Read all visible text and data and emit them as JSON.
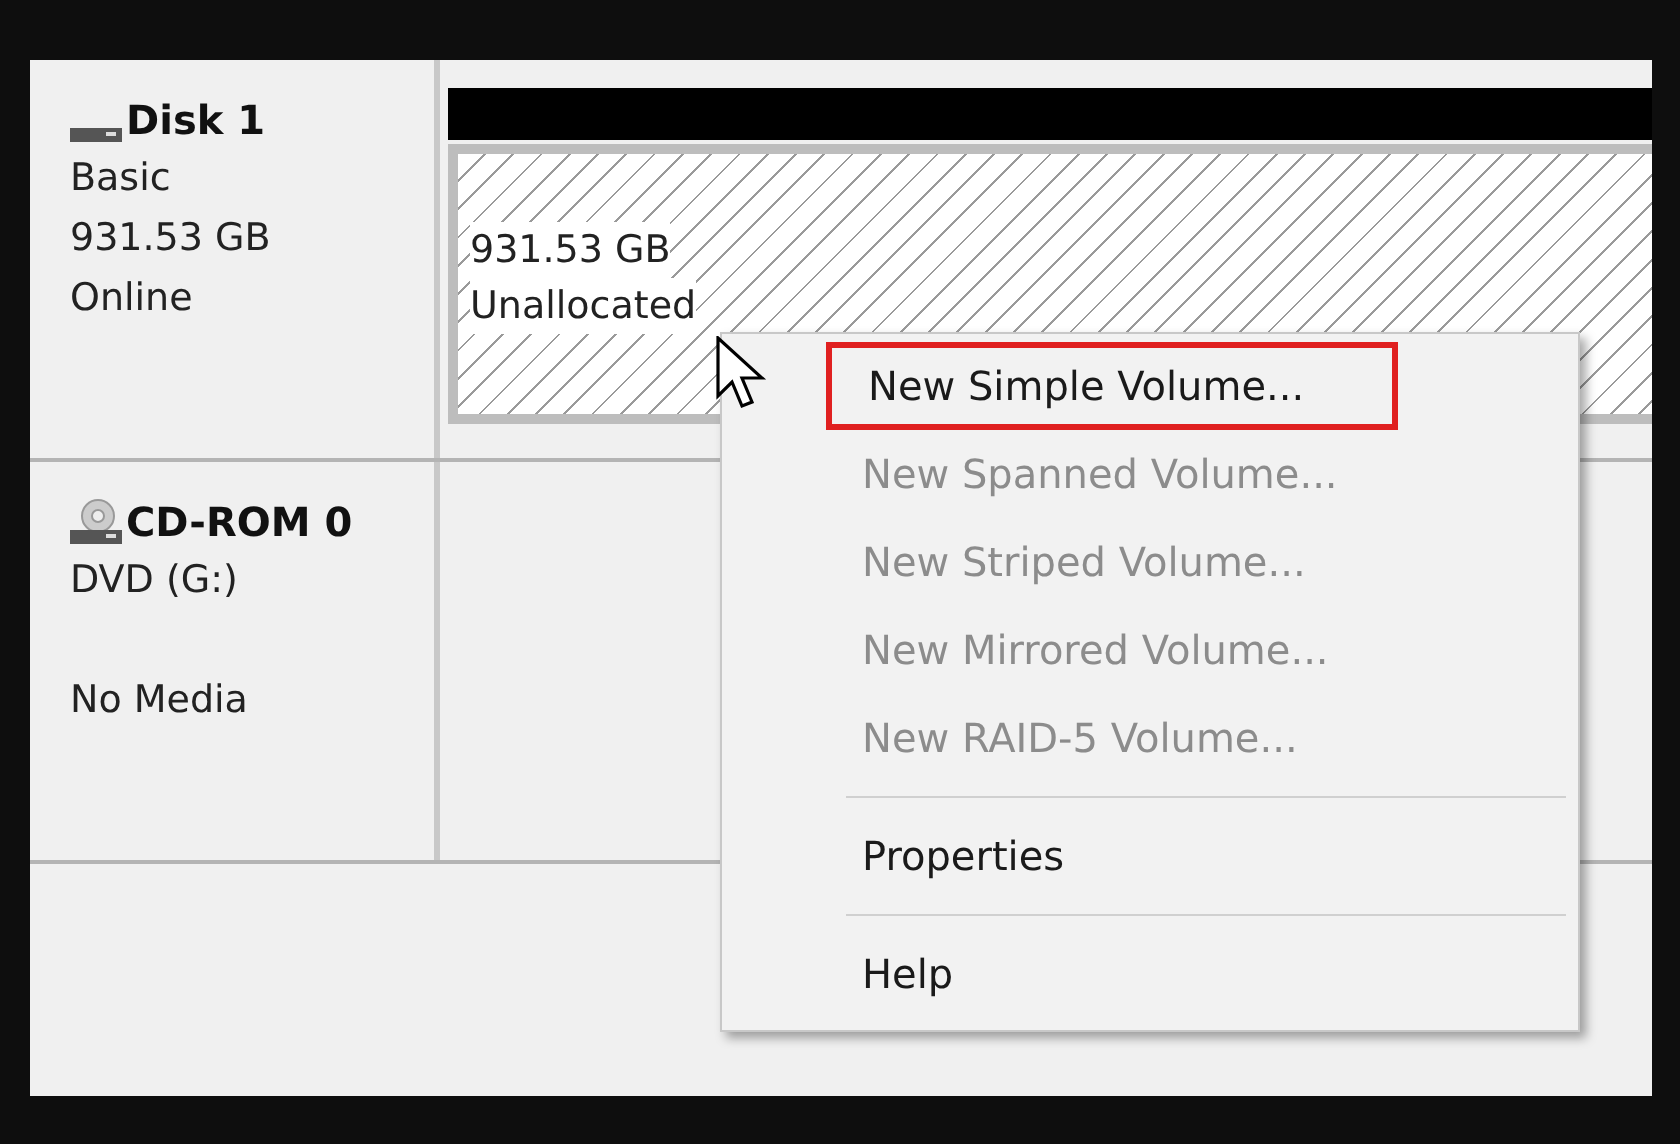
{
  "disks": [
    {
      "kind": "disk",
      "name": "Disk 1",
      "type": "Basic",
      "capacity": "931.53 GB",
      "status": "Online",
      "partition": {
        "kind": "unallocated",
        "size": "931.53 GB",
        "status": "Unallocated"
      }
    },
    {
      "kind": "cdrom",
      "name": "CD-ROM 0",
      "type": "DVD (G:)",
      "status": "No Media"
    }
  ],
  "context_menu": {
    "items": [
      {
        "kind": "item",
        "label": "New Simple Volume...",
        "disabled": false,
        "highlighted": true
      },
      {
        "kind": "item",
        "label": "New Spanned Volume...",
        "disabled": true,
        "highlighted": false
      },
      {
        "kind": "item",
        "label": "New Striped Volume...",
        "disabled": true,
        "highlighted": false
      },
      {
        "kind": "item",
        "label": "New Mirrored Volume...",
        "disabled": true,
        "highlighted": false
      },
      {
        "kind": "item",
        "label": "New RAID-5 Volume...",
        "disabled": true,
        "highlighted": false
      },
      {
        "kind": "separator"
      },
      {
        "kind": "item",
        "label": "Properties",
        "disabled": false,
        "highlighted": false
      },
      {
        "kind": "separator"
      },
      {
        "kind": "item",
        "label": "Help",
        "disabled": false,
        "highlighted": false
      }
    ]
  }
}
